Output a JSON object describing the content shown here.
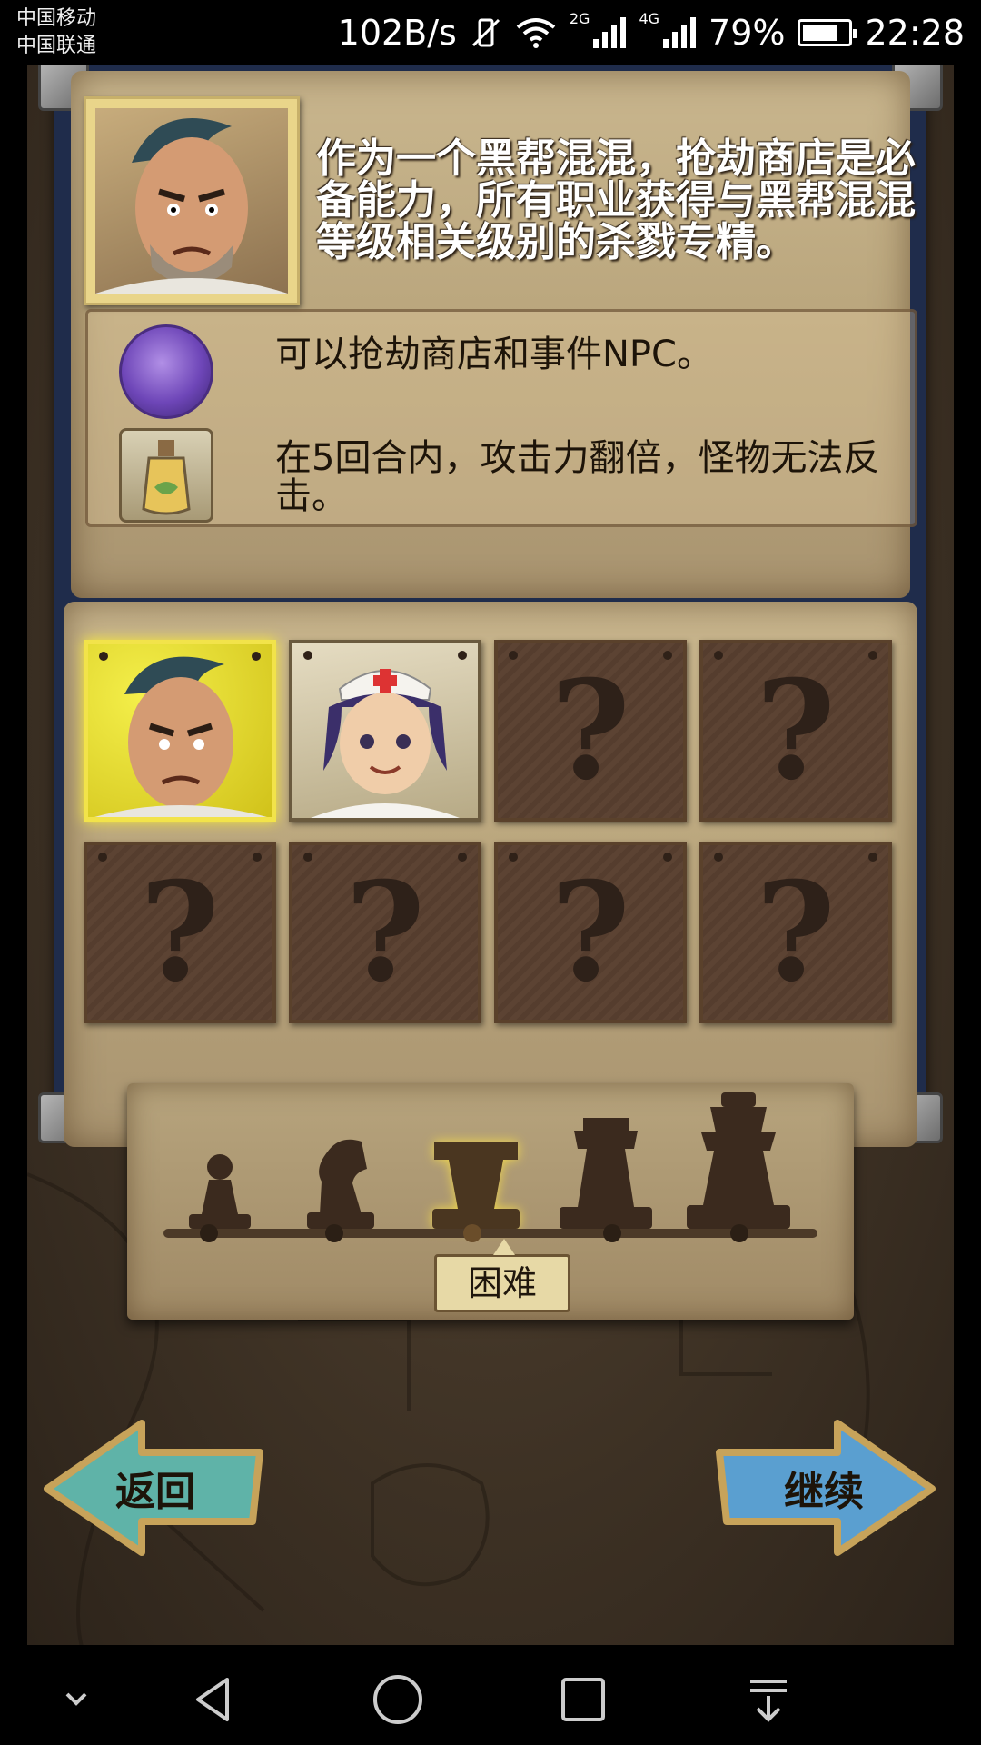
{
  "status_bar": {
    "carrier1": "中国移动",
    "carrier2": "中国联通",
    "speed": "102B/s",
    "net1": "2G",
    "net2": "4G",
    "battery": "79%",
    "time": "22:28"
  },
  "description": {
    "text": "作为一个黑帮混混，抢劫商店是必备能力，所有职业获得与黑帮混混等级相关级别的杀戮专精。"
  },
  "abilities": [
    {
      "icon": "wax-seal-icon",
      "text": "可以抢劫商店和事件NPC。"
    },
    {
      "icon": "potion-icon",
      "text": "在5回合内，攻击力翻倍，怪物无法反击。"
    }
  ],
  "characters": [
    {
      "name": "gangster",
      "state": "selected"
    },
    {
      "name": "nurse",
      "state": "unlocked"
    },
    {
      "name": "locked",
      "state": "locked"
    },
    {
      "name": "locked",
      "state": "locked"
    },
    {
      "name": "locked",
      "state": "locked"
    },
    {
      "name": "locked",
      "state": "locked"
    },
    {
      "name": "locked",
      "state": "locked"
    },
    {
      "name": "locked",
      "state": "locked"
    }
  ],
  "difficulty": {
    "levels": [
      "pawn",
      "knight",
      "rook",
      "bishop",
      "king"
    ],
    "selected_index": 2,
    "selected_label": "困难"
  },
  "nav": {
    "back_label": "返回",
    "continue_label": "继续"
  },
  "colors": {
    "back_button": "#5fb3a8",
    "continue_button": "#5a9fd0",
    "selected_glow": "#f2e34a",
    "book_cover": "#1f2c4b"
  }
}
